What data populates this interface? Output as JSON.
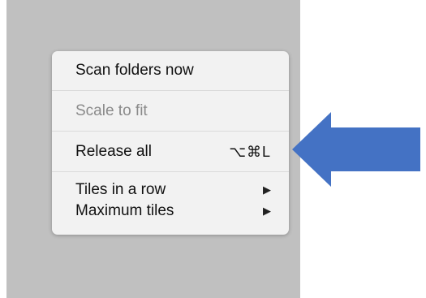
{
  "menu": {
    "items": [
      {
        "label": "Scan folders now",
        "shortcut": "",
        "enabled": true,
        "submenu": false
      },
      {
        "label": "Scale to fit",
        "shortcut": "",
        "enabled": false,
        "submenu": false
      },
      {
        "label": "Release all",
        "shortcut": "⌥⌘L",
        "enabled": true,
        "submenu": false
      },
      {
        "label": "Tiles in a row",
        "shortcut": "",
        "enabled": true,
        "submenu": true
      },
      {
        "label": "Maximum tiles",
        "shortcut": "",
        "enabled": true,
        "submenu": true
      }
    ],
    "submenu_glyph": "▶"
  },
  "annotation": {
    "arrow_color": "#4472c4",
    "arrow_direction": "left",
    "points_to": "Release all"
  },
  "colors": {
    "backdrop": "#c0c0c0",
    "menu_background": "#f2f2f2",
    "disabled_text": "#8a8a8a"
  }
}
